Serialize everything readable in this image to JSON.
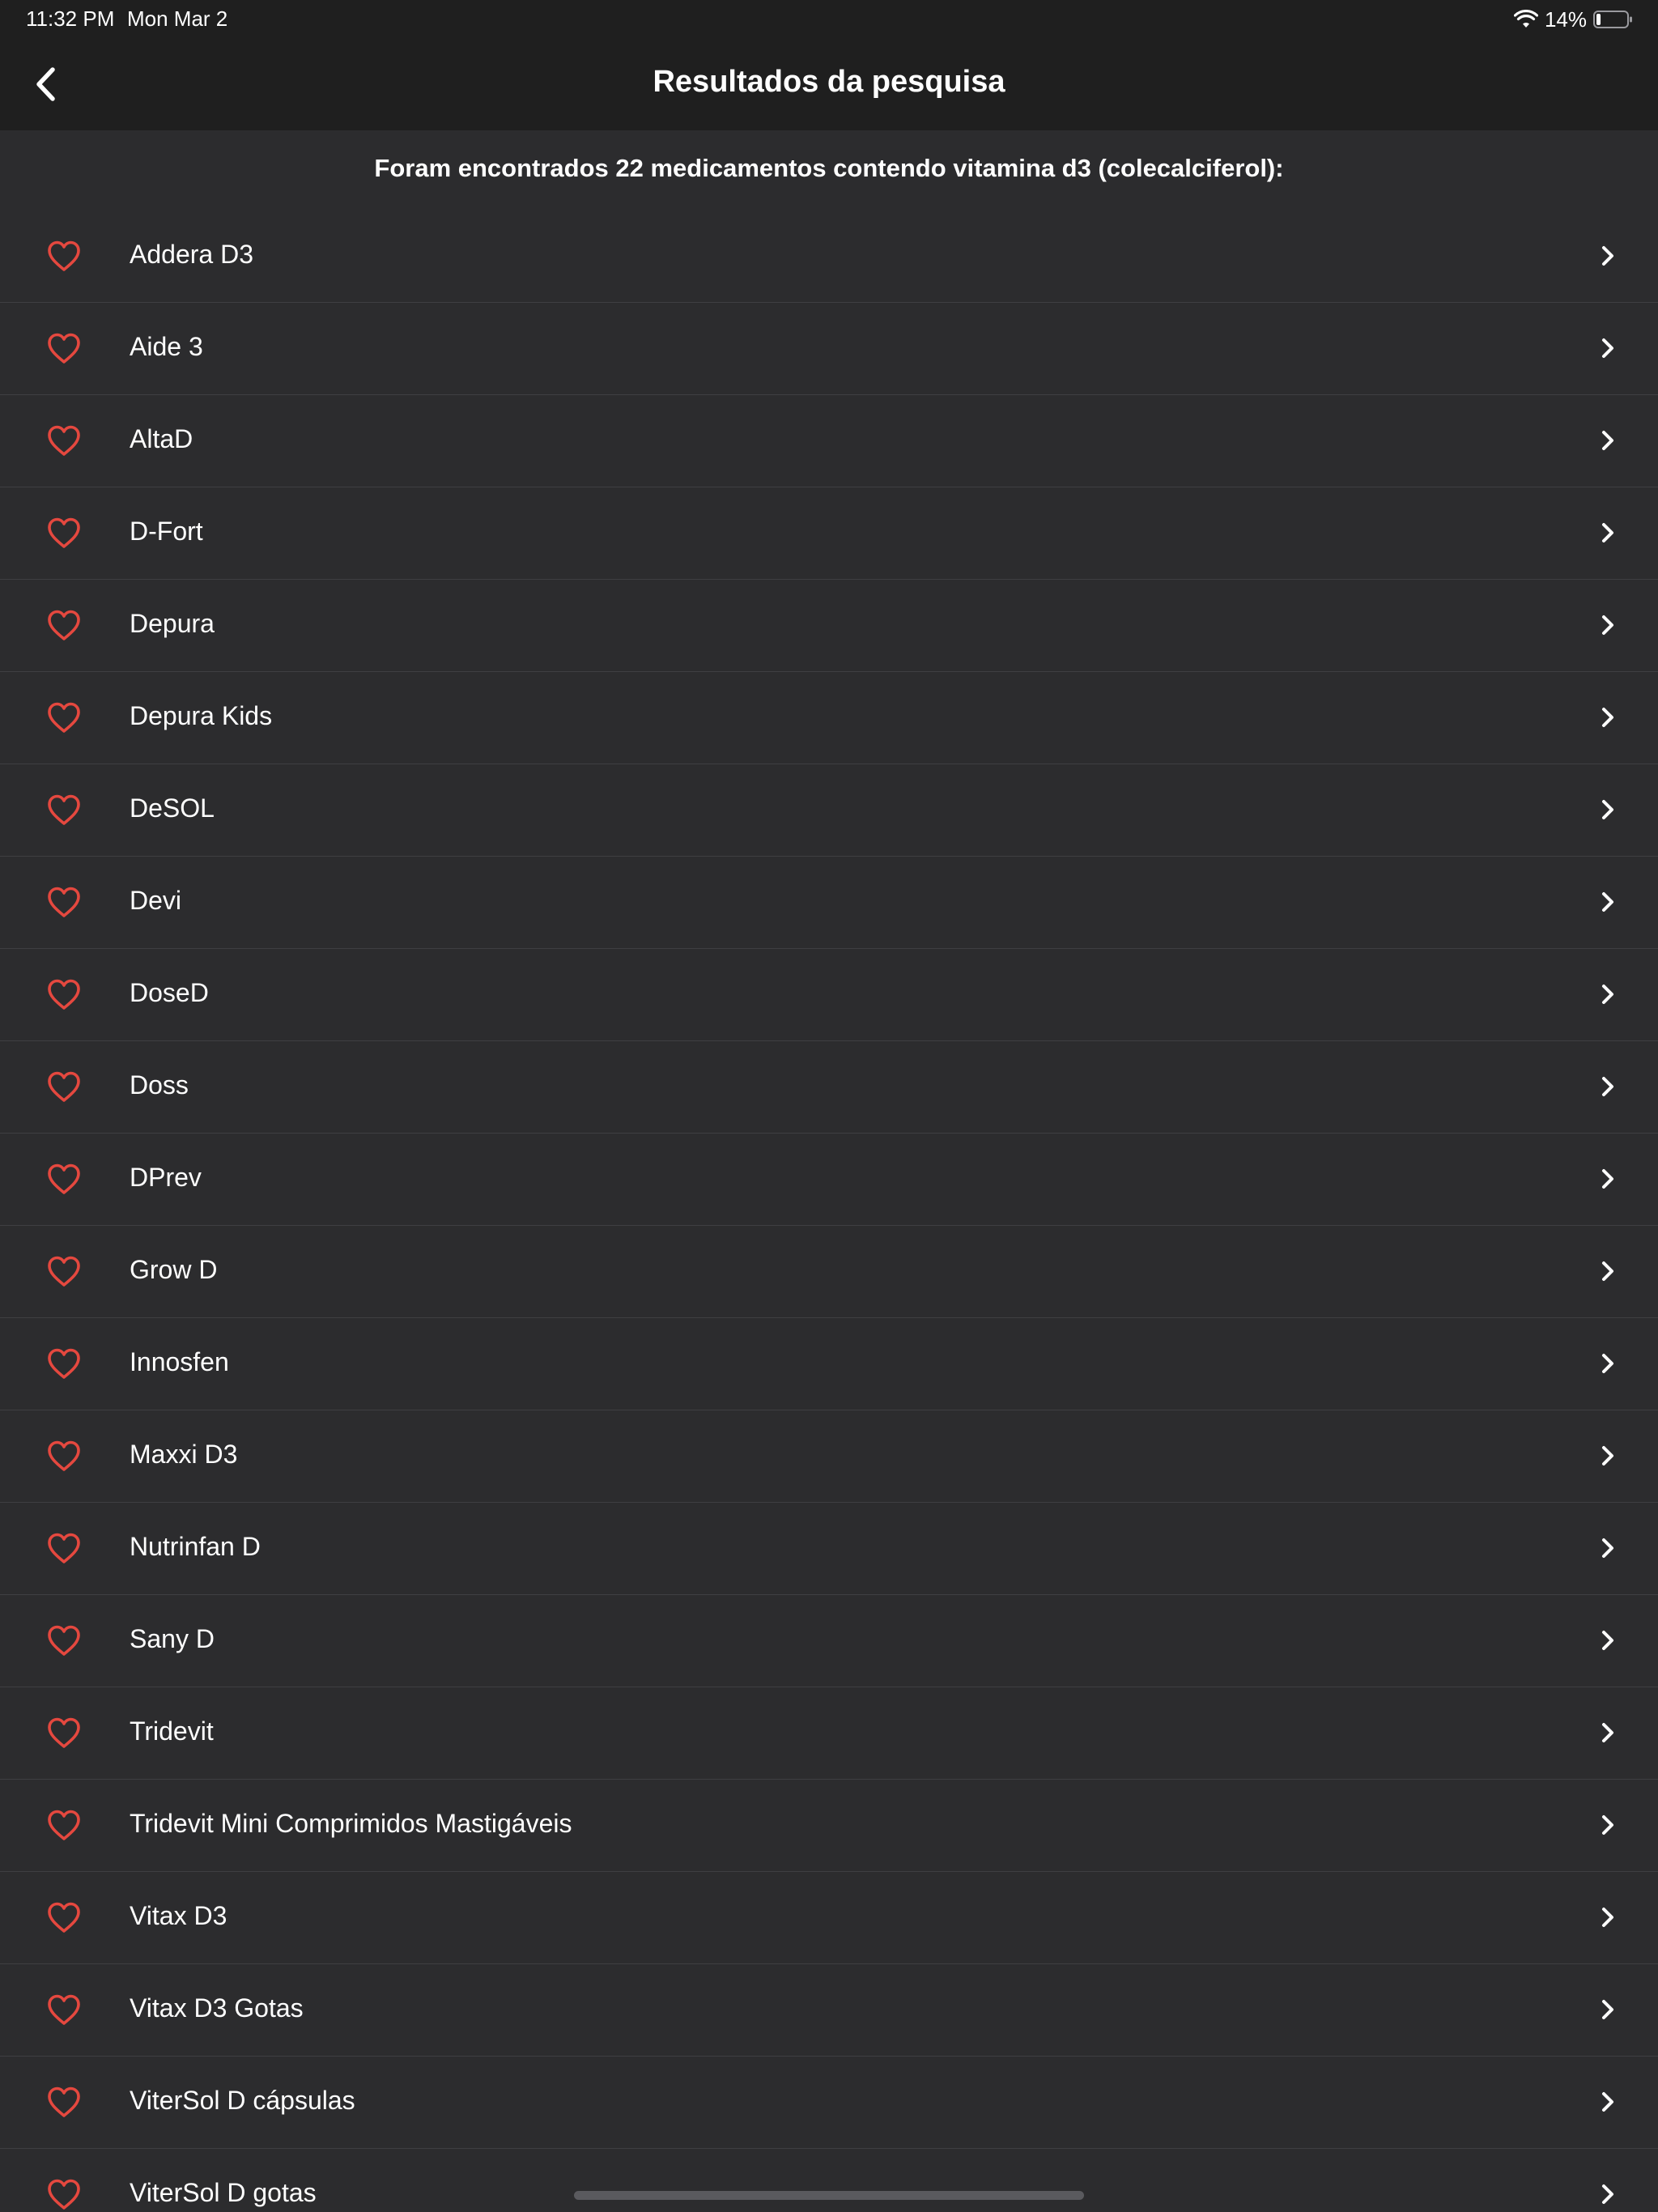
{
  "status_bar": {
    "time": "11:32 PM",
    "date": "Mon Mar 2",
    "battery_percent": "14%",
    "battery_level": 0.14,
    "icons": [
      "wifi-icon",
      "battery-icon"
    ]
  },
  "nav": {
    "title": "Resultados da pesquisa",
    "back_icon": "chevron-left-icon"
  },
  "summary": "Foram encontrados 22 medicamentos contendo vitamina d3 (colecalciferol):",
  "colors": {
    "background": "#2c2c2e",
    "header": "#1f1f1f",
    "heart": "#e5483f",
    "separator": "#3f3f42",
    "text": "#ffffff"
  },
  "results": [
    {
      "label": "Addera D3"
    },
    {
      "label": "Aide 3"
    },
    {
      "label": "AltaD"
    },
    {
      "label": "D-Fort"
    },
    {
      "label": "Depura"
    },
    {
      "label": "Depura Kids"
    },
    {
      "label": "DeSOL"
    },
    {
      "label": "Devi"
    },
    {
      "label": "DoseD"
    },
    {
      "label": "Doss"
    },
    {
      "label": "DPrev"
    },
    {
      "label": "Grow D"
    },
    {
      "label": "Innosfen"
    },
    {
      "label": "Maxxi D3"
    },
    {
      "label": "Nutrinfan D"
    },
    {
      "label": "Sany D"
    },
    {
      "label": "Tridevit"
    },
    {
      "label": "Tridevit Mini Comprimidos Mastigáveis"
    },
    {
      "label": "Vitax D3"
    },
    {
      "label": "Vitax D3 Gotas"
    },
    {
      "label": "ViterSol D cápsulas"
    },
    {
      "label": "ViterSol D gotas"
    }
  ]
}
